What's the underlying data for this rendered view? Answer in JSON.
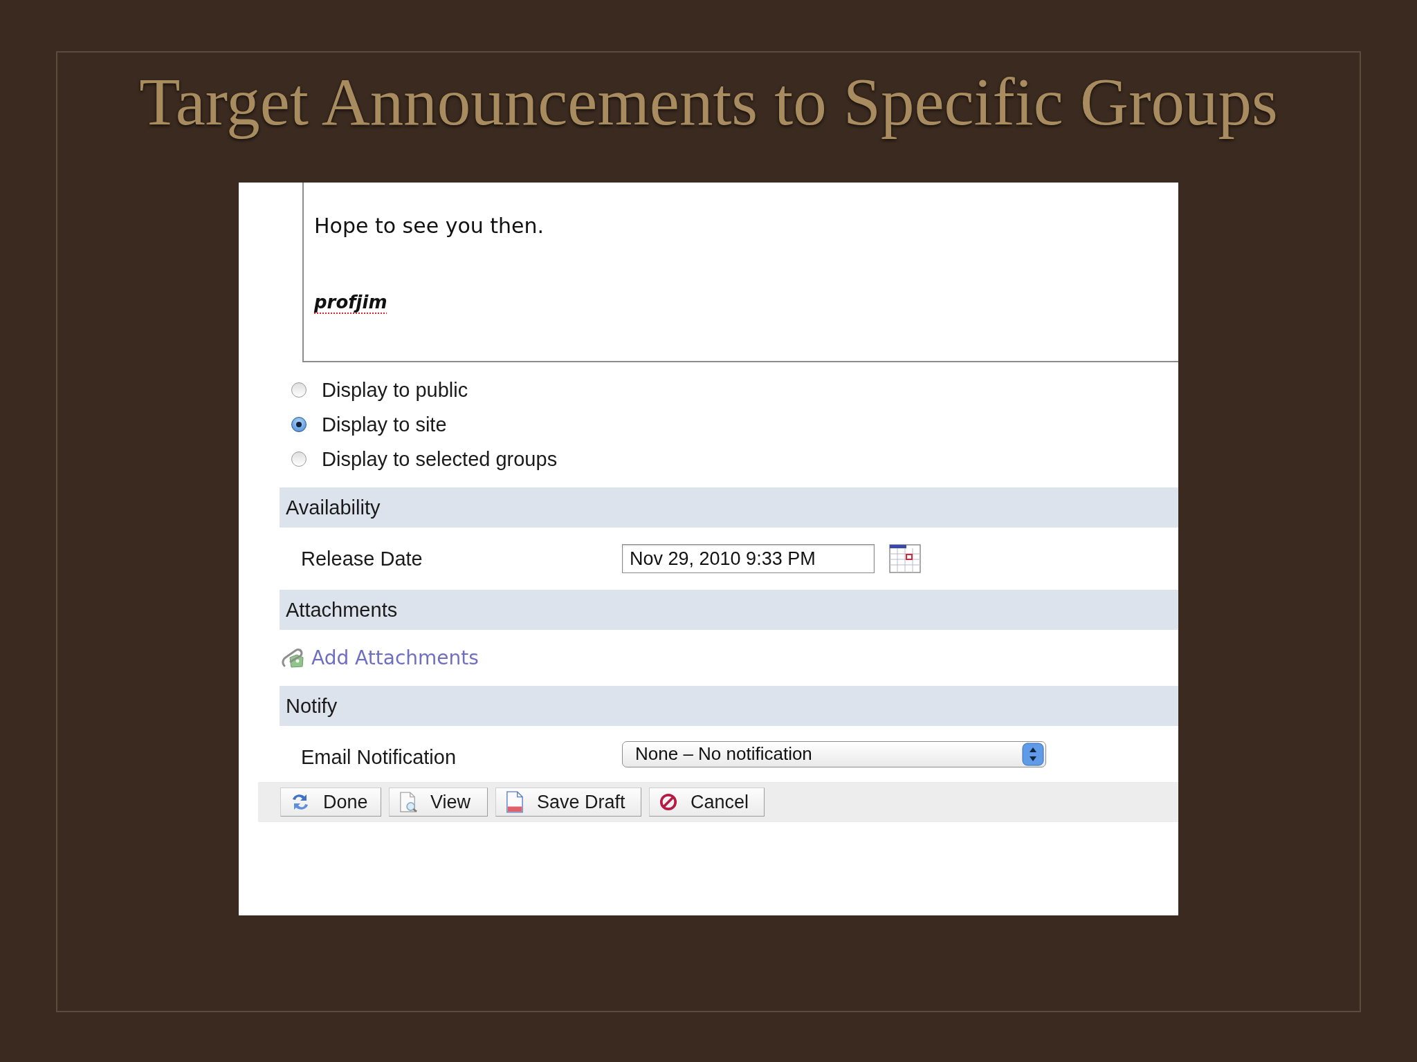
{
  "slide": {
    "title": "Target Announcements to Specific Groups"
  },
  "editor": {
    "lines": [
      {
        "kind": "body",
        "text": "Hope to see you then."
      },
      {
        "kind": "signature",
        "text": "profjim",
        "misspelled": true
      }
    ]
  },
  "access": [
    {
      "label": "Display to public",
      "selected": false
    },
    {
      "label": "Display to site",
      "selected": true
    },
    {
      "label": "Display to selected groups",
      "selected": false
    }
  ],
  "sections": [
    {
      "title": "Availability",
      "row": {
        "kind": "date",
        "label": "Release Date",
        "value": "Nov 29, 2010 9:33 PM"
      }
    },
    {
      "title": "Attachments",
      "row": {
        "kind": "link",
        "label": "Add Attachments"
      }
    },
    {
      "title": "Notify",
      "row": {
        "kind": "select",
        "label": "Email Notification",
        "value": "None – No notification"
      }
    }
  ],
  "buttons": [
    {
      "kind": "done",
      "label": "Done"
    },
    {
      "kind": "view",
      "label": "View"
    },
    {
      "kind": "save",
      "label": "Save Draft"
    },
    {
      "kind": "cancel",
      "label": "Cancel"
    }
  ]
}
